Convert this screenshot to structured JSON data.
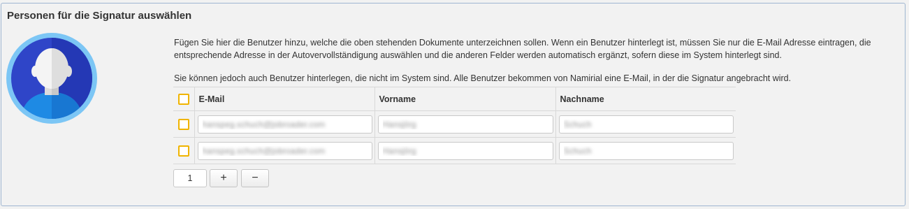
{
  "panel": {
    "title": "Personen für die Signatur auswählen"
  },
  "intro": {
    "paragraph1": "Fügen Sie hier die Benutzer hinzu, welche die oben stehenden Dokumente unterzeichnen sollen. Wenn ein Benutzer hinterlegt ist, müssen Sie nur die E-Mail Adresse eintragen, die entsprechende Adresse in der Autovervollständigung auswählen und die anderen Felder werden automatisch ergänzt, sofern diese im System hinterlegt sind.",
    "paragraph2": "Sie können jedoch auch Benutzer hinterlegen, die nicht im System sind. Alle Benutzer bekommen von Namirial eine E-Mail, in der die Signatur angebracht wird."
  },
  "table": {
    "headers": {
      "email": "E-Mail",
      "vorname": "Vorname",
      "nachname": "Nachname"
    },
    "rows": [
      {
        "email": "hanspeg.schuch@jobroader.com",
        "vorname": "Hansjörg",
        "nachname": "Schuch"
      },
      {
        "email": "hanspeg.schuch@jobroader.com",
        "vorname": "Hansjörg",
        "nachname": "Schuch"
      }
    ]
  },
  "pager": {
    "count": "1",
    "plus": "+",
    "minus": "−"
  },
  "icons": {
    "avatar": "user-avatar-icon",
    "checkbox": "checkbox-icon"
  },
  "colors": {
    "checkbox_border": "#f0b400",
    "panel_border": "#9fb6d1",
    "avatar_ring": "#5ab4f0",
    "avatar_bg": "#3a4fd0",
    "avatar_body": "#1f86e0"
  }
}
